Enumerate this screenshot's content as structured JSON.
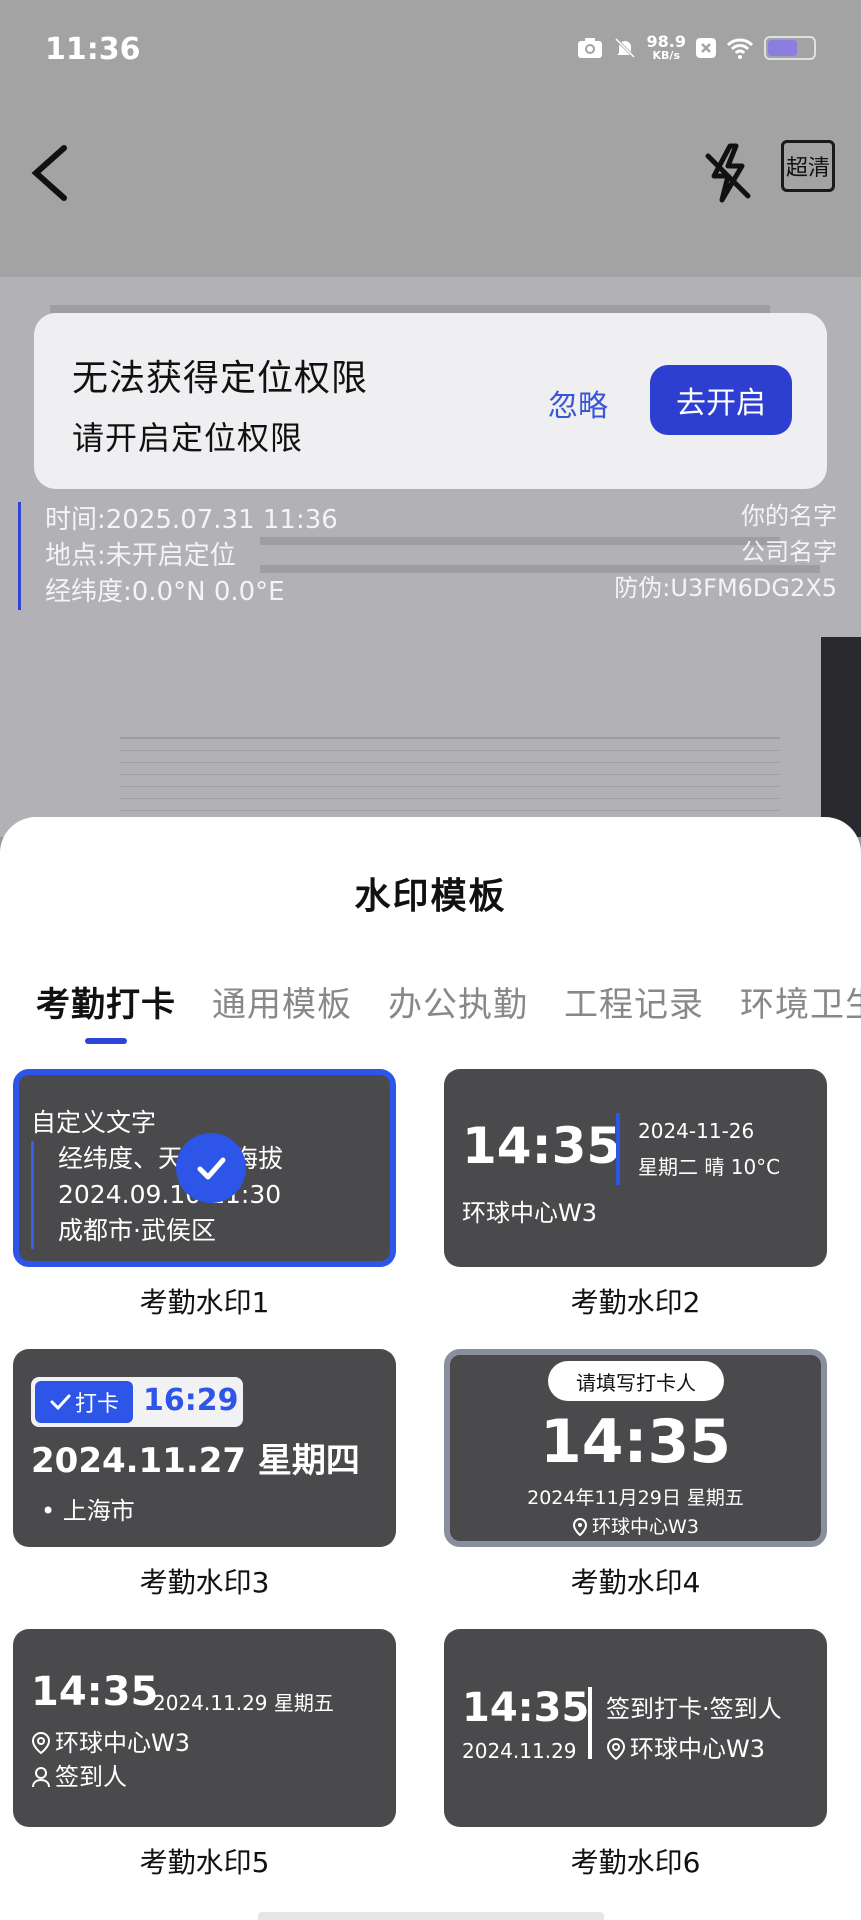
{
  "status_bar": {
    "time": "11:36",
    "net_speed_value": "98.9",
    "net_speed_unit": "KB/s"
  },
  "header": {
    "hd_label": "超清"
  },
  "permission_banner": {
    "title": "无法获得定位权限",
    "subtitle": "请开启定位权限",
    "ignore_label": "忽略",
    "enable_label": "去开启"
  },
  "watermark_preview": {
    "time_line": "时间:2025.07.31 11:36",
    "location_line": "地点:未开启定位",
    "coords_line": "经纬度:0.0°N 0.0°E",
    "name": "你的名字",
    "company": "公司名字",
    "anti_fake": "防伪:U3FM6DG2X5"
  },
  "sheet": {
    "title": "水印模板",
    "tabs": [
      "考勤打卡",
      "通用模板",
      "办公执勤",
      "工程记录",
      "环境卫生"
    ],
    "active_tab_index": 0
  },
  "templates": [
    {
      "caption": "考勤水印1",
      "selected": true,
      "custom_text": "自定义文字",
      "line1": "经纬度、天气、海拔",
      "line2": "2024.09.10 11:30",
      "line3": "成都市·武侯区"
    },
    {
      "caption": "考勤水印2",
      "time": "14:35",
      "date": "2024-11-26",
      "weekday_weather": "星期二 晴 10°C",
      "location": "环球中心W3"
    },
    {
      "caption": "考勤水印3",
      "tag": "打卡",
      "time": "16:29",
      "date": "2024.11.27 星期四",
      "location": "上海市"
    },
    {
      "caption": "考勤水印4",
      "fill_prompt": "请填写打卡人",
      "time": "14:35",
      "date": "2024年11月29日 星期五",
      "location": "环球中心W3"
    },
    {
      "caption": "考勤水印5",
      "time": "14:35",
      "date": "2024.11.29 星期五",
      "location": "环球中心W3",
      "user": "签到人"
    },
    {
      "caption": "考勤水印6",
      "time": "14:35",
      "date": "2024.11.29",
      "sign": "签到打卡·签到人",
      "location": "环球中心W3"
    }
  ],
  "colors": {
    "accent": "#2d55e8",
    "button": "#2d3fd1",
    "card_bg": "#4a4a4c"
  }
}
